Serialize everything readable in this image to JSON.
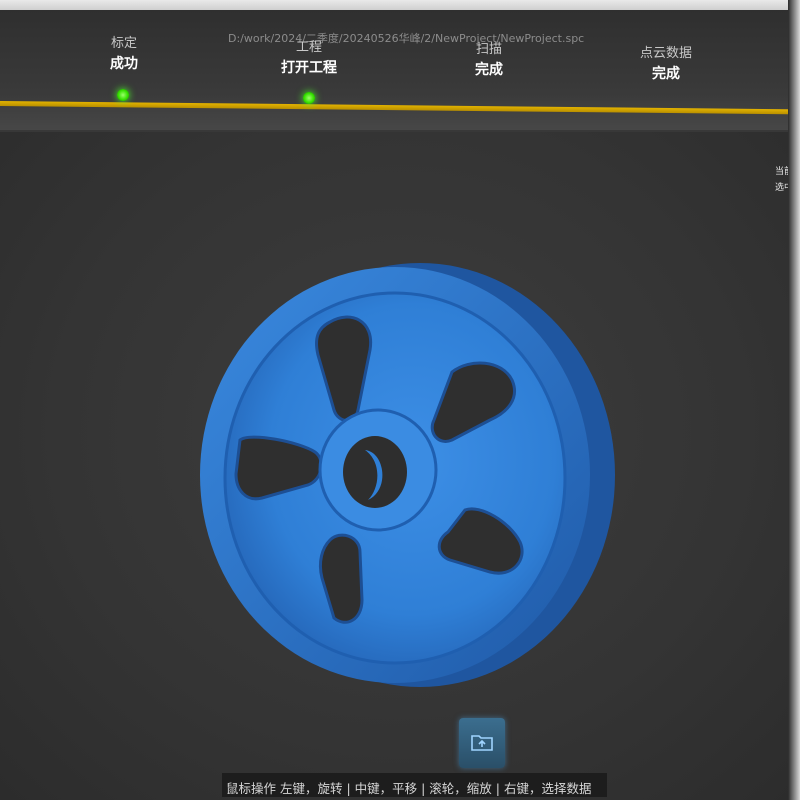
{
  "window": {
    "file_path": "D:/work/2024/二季度/20240526华峰/2/NewProject/NewProject.spc"
  },
  "workflow": {
    "steps": [
      {
        "label": "标定",
        "status": "成功"
      },
      {
        "label": "工程",
        "status": "打开工程"
      },
      {
        "label": "扫描",
        "status": "完成"
      },
      {
        "label": "点云数据",
        "status": "完成"
      }
    ]
  },
  "side_panel": {
    "line1": "当前三",
    "line2": "选中三"
  },
  "status_bar": {
    "hint": "鼠标操作 左键，旋转 | 中键，平移 | 滚轮，缩放 | 右键，选择数据"
  },
  "icons": {
    "bottom_button": "folder-open-icon"
  },
  "colors": {
    "model_blue": "#2f7fd6",
    "progress_gold": "#d4a800",
    "done_dot_green": "#36e000",
    "accent_blue": "#4a9fd8"
  }
}
